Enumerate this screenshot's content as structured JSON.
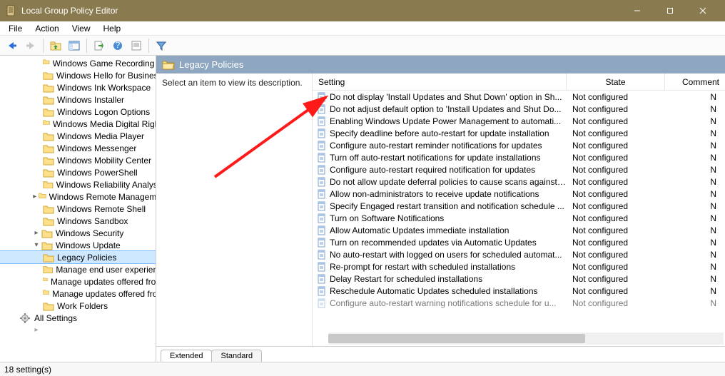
{
  "window": {
    "title": "Local Group Policy Editor"
  },
  "menu": {
    "file": "File",
    "action": "Action",
    "view": "View",
    "help": "Help"
  },
  "tree": {
    "items": [
      {
        "label": "Windows Game Recording and Broadcasting"
      },
      {
        "label": "Windows Hello for Business"
      },
      {
        "label": "Windows Ink Workspace"
      },
      {
        "label": "Windows Installer"
      },
      {
        "label": "Windows Logon Options"
      },
      {
        "label": "Windows Media Digital Rights Management"
      },
      {
        "label": "Windows Media Player"
      },
      {
        "label": "Windows Messenger"
      },
      {
        "label": "Windows Mobility Center"
      },
      {
        "label": "Windows PowerShell"
      },
      {
        "label": "Windows Reliability Analysis"
      },
      {
        "label": "Windows Remote Management (WinRM)",
        "chev": ">"
      },
      {
        "label": "Windows Remote Shell"
      },
      {
        "label": "Windows Sandbox"
      },
      {
        "label": "Windows Security",
        "chev": ">"
      },
      {
        "label": "Windows Update",
        "chev": "v"
      },
      {
        "label": "Legacy Policies",
        "selected": true,
        "child": true
      },
      {
        "label": "Manage end user experience",
        "child": true
      },
      {
        "label": "Manage updates offered from Windows Server Update Service",
        "child": true
      },
      {
        "label": "Manage updates offered from Windows Update",
        "child": true
      },
      {
        "label": "Work Folders"
      }
    ],
    "all_settings": "All Settings"
  },
  "location": {
    "title": "Legacy Policies"
  },
  "description_prompt": "Select an item to view its description.",
  "columns": {
    "setting": "Setting",
    "state": "State",
    "comment": "Comment"
  },
  "policies": [
    {
      "name": "Do not display 'Install Updates and Shut Down' option in Sh...",
      "state": "Not configured",
      "comment": "No"
    },
    {
      "name": "Do not adjust default option to 'Install Updates and Shut Do...",
      "state": "Not configured",
      "comment": "No"
    },
    {
      "name": "Enabling Windows Update Power Management to automati...",
      "state": "Not configured",
      "comment": "No"
    },
    {
      "name": "Specify deadline before auto-restart for update installation",
      "state": "Not configured",
      "comment": "No"
    },
    {
      "name": "Configure auto-restart reminder notifications for updates",
      "state": "Not configured",
      "comment": "No"
    },
    {
      "name": "Turn off auto-restart notifications for update installations",
      "state": "Not configured",
      "comment": "No"
    },
    {
      "name": "Configure auto-restart required notification for updates",
      "state": "Not configured",
      "comment": "No"
    },
    {
      "name": "Do not allow update deferral policies to cause scans against ...",
      "state": "Not configured",
      "comment": "No"
    },
    {
      "name": "Allow non-administrators to receive update notifications",
      "state": "Not configured",
      "comment": "No"
    },
    {
      "name": "Specify Engaged restart transition and notification schedule ...",
      "state": "Not configured",
      "comment": "No"
    },
    {
      "name": "Turn on Software Notifications",
      "state": "Not configured",
      "comment": "No"
    },
    {
      "name": "Allow Automatic Updates immediate installation",
      "state": "Not configured",
      "comment": "No"
    },
    {
      "name": "Turn on recommended updates via Automatic Updates",
      "state": "Not configured",
      "comment": "No"
    },
    {
      "name": "No auto-restart with logged on users for scheduled automat...",
      "state": "Not configured",
      "comment": "No"
    },
    {
      "name": "Re-prompt for restart with scheduled installations",
      "state": "Not configured",
      "comment": "No"
    },
    {
      "name": "Delay Restart for scheduled installations",
      "state": "Not configured",
      "comment": "No"
    },
    {
      "name": "Reschedule Automatic Updates scheduled installations",
      "state": "Not configured",
      "comment": "No"
    },
    {
      "name": "Configure auto-restart warning notifications schedule for u...",
      "state": "Not configured",
      "comment": "No"
    }
  ],
  "tabs": {
    "extended": "Extended",
    "standard": "Standard"
  },
  "status": "18 setting(s)",
  "comment_short": "N"
}
